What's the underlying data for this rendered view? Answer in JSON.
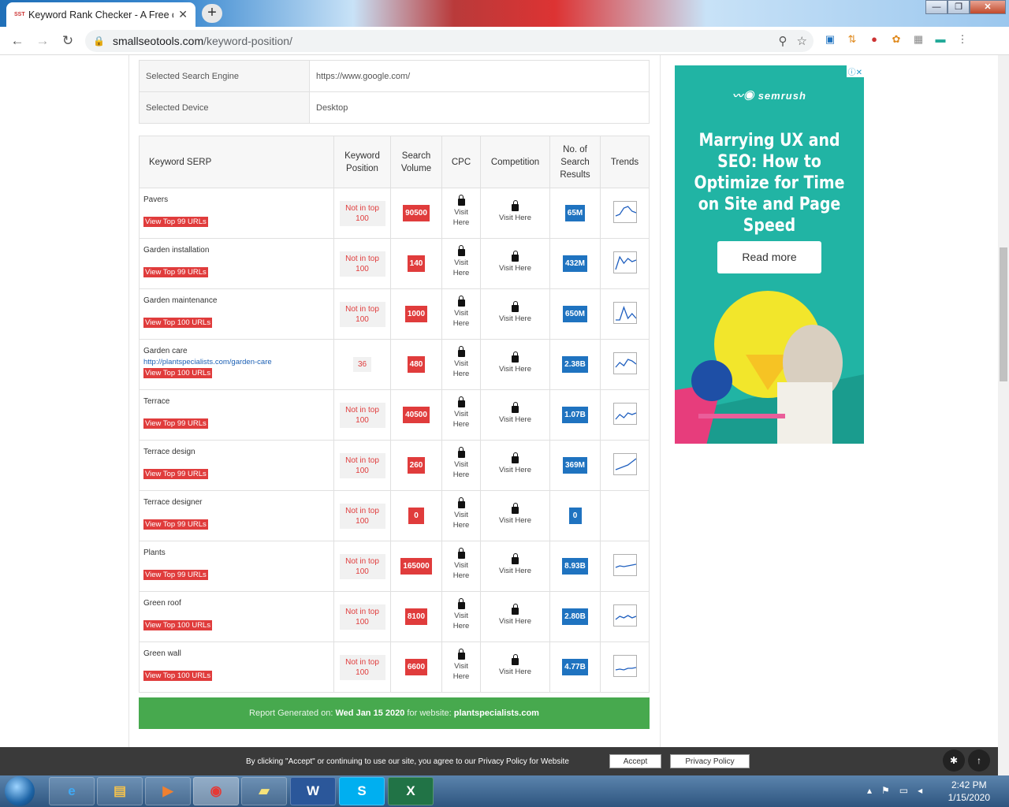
{
  "browser": {
    "tab_title": "Keyword Rank Checker - A Free c",
    "tab_favicon": "SST",
    "url_host": "smallseotools.com",
    "url_path": "/keyword-position/",
    "window_buttons": [
      "—",
      "❐",
      "✕"
    ]
  },
  "settings": [
    {
      "label": "Selected Search Engine",
      "value": "https://www.google.com/"
    },
    {
      "label": "Selected Device",
      "value": "Desktop"
    }
  ],
  "table_headers": {
    "keyword": "Keyword SERP",
    "position": "Keyword Position",
    "volume": "Search Volume",
    "cpc": "CPC",
    "competition": "Competition",
    "results": "No. of Search Results",
    "trends": "Trends"
  },
  "lock_text": "Visit Here",
  "rows": [
    {
      "keyword": "Pavers",
      "url": "",
      "view": "View Top 99 URLs",
      "position": "Not in top 100",
      "volume": "90500",
      "results": "65M",
      "trend": [
        0.3,
        0.4,
        0.8,
        0.9,
        0.6,
        0.5
      ]
    },
    {
      "keyword": "Garden installation",
      "url": "",
      "view": "View Top 99 URLs",
      "position": "Not in top 100",
      "volume": "140",
      "results": "432M",
      "trend": [
        0.1,
        0.9,
        0.5,
        0.8,
        0.6,
        0.7
      ]
    },
    {
      "keyword": "Garden maintenance",
      "url": "",
      "view": "View Top 100 URLs",
      "position": "Not in top 100",
      "volume": "1000",
      "results": "650M",
      "trend": [
        0.1,
        0.1,
        0.9,
        0.2,
        0.5,
        0.2
      ]
    },
    {
      "keyword": "Garden care",
      "url": "http://plantspecialists.com/garden-care",
      "view": "View Top 100 URLs",
      "position": "36",
      "volume": "480",
      "results": "2.38B",
      "trend": [
        0.3,
        0.6,
        0.4,
        0.8,
        0.7,
        0.5
      ]
    },
    {
      "keyword": "Terrace",
      "url": "",
      "view": "View Top 99 URLs",
      "position": "Not in top 100",
      "volume": "40500",
      "results": "1.07B",
      "trend": [
        0.2,
        0.5,
        0.3,
        0.6,
        0.5,
        0.6
      ]
    },
    {
      "keyword": "Terrace design",
      "url": "",
      "view": "View Top 99 URLs",
      "position": "Not in top 100",
      "volume": "260",
      "results": "369M",
      "trend": [
        0.2,
        0.3,
        0.4,
        0.5,
        0.7,
        0.9
      ]
    },
    {
      "keyword": "Terrace designer",
      "url": "",
      "view": "View Top 99 URLs",
      "position": "Not in top 100",
      "volume": "0",
      "results": "0",
      "trend": []
    },
    {
      "keyword": "Plants",
      "url": "",
      "view": "View Top 99 URLs",
      "position": "Not in top 100",
      "volume": "165000",
      "results": "8.93B",
      "trend": [
        0.4,
        0.5,
        0.45,
        0.5,
        0.55,
        0.6
      ]
    },
    {
      "keyword": "Green roof",
      "url": "",
      "view": "View Top 100 URLs",
      "position": "Not in top 100",
      "volume": "8100",
      "results": "2.80B",
      "trend": [
        0.3,
        0.5,
        0.4,
        0.55,
        0.4,
        0.5
      ]
    },
    {
      "keyword": "Green wall",
      "url": "",
      "view": "View Top 100 URLs",
      "position": "Not in top 100",
      "volume": "6600",
      "results": "4.77B",
      "trend": [
        0.3,
        0.35,
        0.3,
        0.4,
        0.4,
        0.45
      ]
    }
  ],
  "report": {
    "prefix": "Report Generated on:",
    "date": "Wed Jan 15 2020",
    "middle": "for website:",
    "site": "plantspecialists.com"
  },
  "ad": {
    "brand": "semrush",
    "headline": "Marrying UX and SEO: How to Optimize for Time on Site and Page Speed",
    "cta": "Read more",
    "adchoice": "ⓘ✕"
  },
  "cookie": {
    "message": "By clicking \"Accept\" or continuing to use our site, you agree to our Privacy Policy for Website",
    "accept": "Accept",
    "privacy": "Privacy Policy"
  },
  "taskbar": {
    "time": "2:42 PM",
    "date": "1/15/2020"
  },
  "colors": {
    "red": "#e03c3c",
    "blue": "#1f73c0",
    "green": "#47a94e",
    "ad_bg": "#21b4a4"
  }
}
